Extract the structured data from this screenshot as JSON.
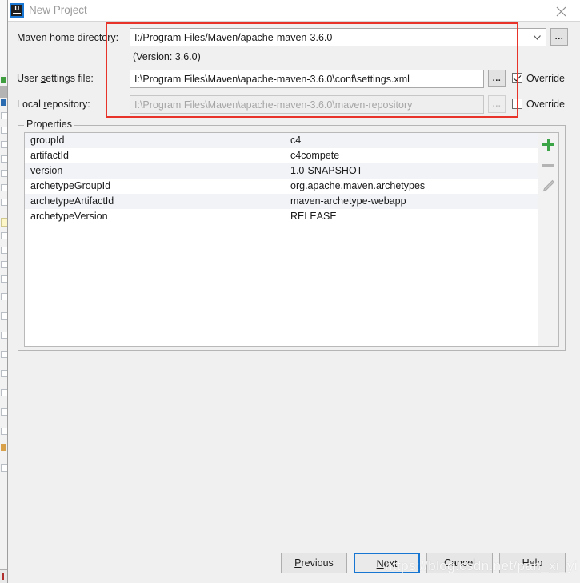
{
  "window": {
    "title": "New Project",
    "app_icon": "intellij-idea-icon",
    "icon_text": "IJ",
    "close_icon": "close-icon"
  },
  "maven": {
    "home_label_pre": "Maven ",
    "home_label_key": "h",
    "home_label_post": "ome directory:",
    "home_label_full": "Maven home directory:",
    "home_value": "I:/Program Files/Maven/apache-maven-3.6.0",
    "home_browse_label": "...",
    "version_text": "(Version: 3.6.0)",
    "settings_label_pre": "User ",
    "settings_label_key": "s",
    "settings_label_post": "ettings file:",
    "settings_label_full": "User settings file:",
    "settings_value": "I:\\Program Files\\Maven\\apache-maven-3.6.0\\conf\\settings.xml",
    "settings_browse_label": "...",
    "settings_override_label": "Override",
    "settings_override_checked": true,
    "repo_label_pre": "Local ",
    "repo_label_key": "r",
    "repo_label_post": "epository:",
    "repo_label_full": "Local repository:",
    "repo_value": "I:\\Program Files\\Maven\\apache-maven-3.6.0\\maven-repository",
    "repo_browse_label": "...",
    "repo_override_label": "Override",
    "repo_override_checked": false
  },
  "properties": {
    "legend": "Properties",
    "rows": [
      {
        "name": "groupId",
        "value": "c4"
      },
      {
        "name": "artifactId",
        "value": "c4compete"
      },
      {
        "name": "version",
        "value": "1.0-SNAPSHOT"
      },
      {
        "name": "archetypeGroupId",
        "value": "org.apache.maven.archetypes"
      },
      {
        "name": "archetypeArtifactId",
        "value": "maven-archetype-webapp"
      },
      {
        "name": "archetypeVersion",
        "value": "RELEASE"
      }
    ],
    "toolbar": {
      "add_icon": "plus-icon",
      "remove_icon": "minus-icon",
      "edit_icon": "pencil-icon",
      "add_color": "#3ba447",
      "disabled_color": "#b4b4b4"
    }
  },
  "footer": {
    "previous_pre": "",
    "previous_key": "P",
    "previous_post": "revious",
    "previous_label": "Previous",
    "next_pre": "",
    "next_key": "N",
    "next_post": "ext",
    "next_label": "Next",
    "cancel_label": "Cancel",
    "help_label": "Help"
  },
  "annotation": {
    "color": "#e8332a"
  },
  "watermark": {
    "text": "https://blog.csdn.net/pan_xi_yi"
  }
}
